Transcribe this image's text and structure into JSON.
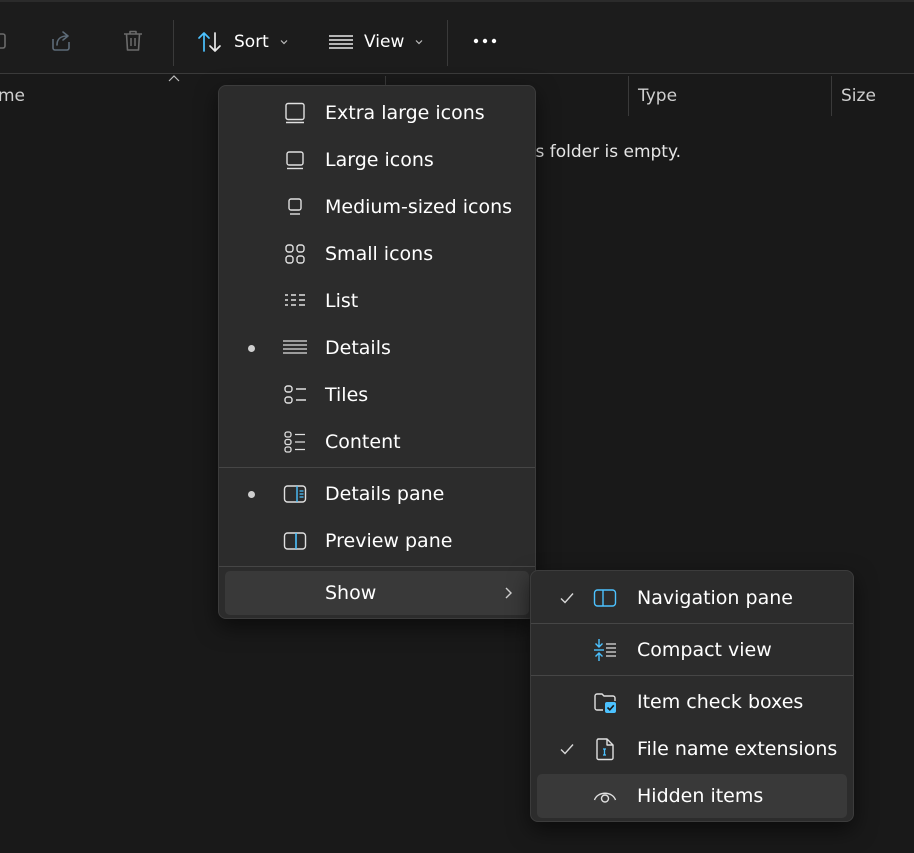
{
  "toolbar": {
    "sort_label": "Sort",
    "view_label": "View",
    "icons": [
      "share-icon",
      "delete-icon",
      "sort-icon",
      "view-icon",
      "more-icon"
    ]
  },
  "columns": {
    "name": "me",
    "type": "Type",
    "size": "Size"
  },
  "empty_message": "This folder is empty.",
  "empty_message_visible": "his folder is empty.",
  "view_menu": {
    "items": [
      {
        "label": "Extra large icons",
        "icon": "extra-large-icons-icon",
        "selected": false
      },
      {
        "label": "Large icons",
        "icon": "large-icons-icon",
        "selected": false
      },
      {
        "label": "Medium-sized icons",
        "icon": "medium-icons-icon",
        "selected": false
      },
      {
        "label": "Small icons",
        "icon": "small-icons-icon",
        "selected": false
      },
      {
        "label": "List",
        "icon": "list-icon",
        "selected": false
      },
      {
        "label": "Details",
        "icon": "details-icon",
        "selected": true
      },
      {
        "label": "Tiles",
        "icon": "tiles-icon",
        "selected": false
      },
      {
        "label": "Content",
        "icon": "content-icon",
        "selected": false
      }
    ],
    "panes": [
      {
        "label": "Details pane",
        "icon": "details-pane-icon",
        "selected": true
      },
      {
        "label": "Preview pane",
        "icon": "preview-pane-icon",
        "selected": false
      }
    ],
    "show_label": "Show"
  },
  "show_menu": {
    "items": [
      {
        "label": "Navigation pane",
        "icon": "navigation-pane-icon",
        "checked": true
      },
      {
        "label": "Compact view",
        "icon": "compact-view-icon",
        "checked": false
      },
      {
        "label": "Item check boxes",
        "icon": "item-check-boxes-icon",
        "checked": false
      },
      {
        "label": "File name extensions",
        "icon": "file-extensions-icon",
        "checked": true
      },
      {
        "label": "Hidden items",
        "icon": "hidden-items-icon",
        "checked": false
      }
    ]
  },
  "colors": {
    "accent": "#4cc2ff",
    "menu_bg": "#2c2c2c",
    "window_bg": "#191919"
  }
}
